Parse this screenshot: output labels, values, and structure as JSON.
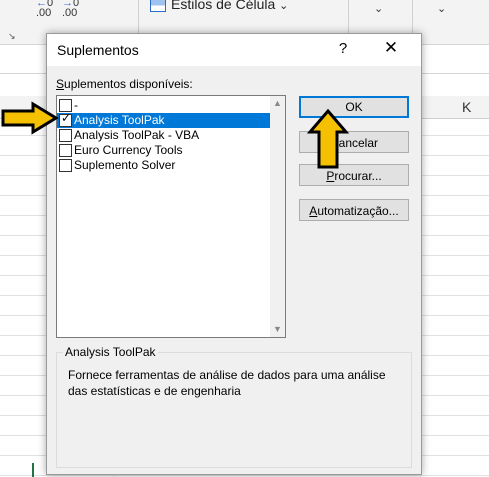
{
  "ribbon": {
    "increase_decimals_label": "←0\n.00",
    "decrease_decimals_label": ".00\n→0",
    "styles_label": "Estilos de Célula",
    "styles_chevron": "⌄",
    "launcher_icon": "↘"
  },
  "sheet": {
    "column_k": "K"
  },
  "dialog": {
    "title": "Suplementos",
    "help": "?",
    "close": "✕",
    "available_label_first": "S",
    "available_label_rest": "uplementos disponíveis:",
    "items": [
      {
        "label": "-",
        "checked": false,
        "selected": false
      },
      {
        "label": "Analysis ToolPak",
        "checked": true,
        "selected": true
      },
      {
        "label": "Analysis ToolPak - VBA",
        "checked": false,
        "selected": false
      },
      {
        "label": "Euro Currency Tools",
        "checked": false,
        "selected": false
      },
      {
        "label": "Suplemento Solver",
        "checked": false,
        "selected": false
      }
    ],
    "buttons": {
      "ok": "OK",
      "cancel": "Cancelar",
      "browse_first": "P",
      "browse_rest": "rocurar...",
      "automation_first": "A",
      "automation_rest": "utomatização..."
    },
    "description": {
      "title": "Analysis ToolPak",
      "text": "Fornece ferramentas de análise de dados para uma análise das estatísticas e de engenharia"
    }
  },
  "colors": {
    "accent": "#0078d7",
    "arrow_fill": "#f5c000"
  }
}
